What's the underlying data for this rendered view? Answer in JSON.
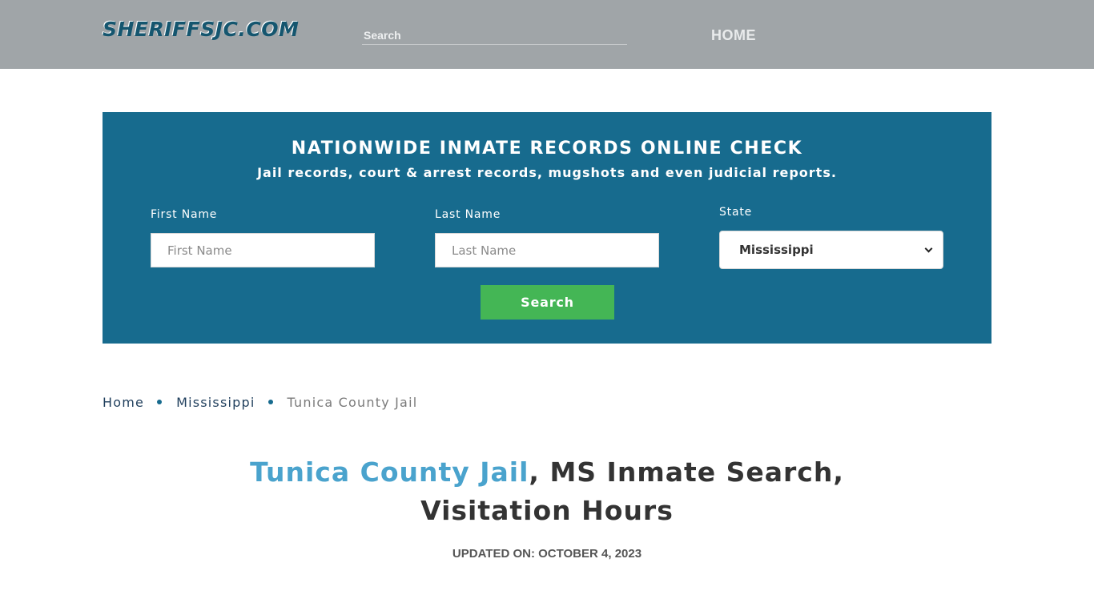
{
  "header": {
    "logo": "SHERIFFSJC.COM",
    "search_placeholder": "Search",
    "nav": {
      "home": "HOME"
    }
  },
  "banner": {
    "title": "NATIONWIDE INMATE RECORDS ONLINE CHECK",
    "subtitle": "Jail records, court & arrest records, mugshots and even judicial reports.",
    "first_name": {
      "label": "First Name",
      "placeholder": "First Name"
    },
    "last_name": {
      "label": "Last Name",
      "placeholder": "Last Name"
    },
    "state": {
      "label": "State",
      "selected": "Mississippi"
    },
    "search_button": "Search"
  },
  "breadcrumb": {
    "items": [
      "Home",
      "Mississippi",
      "Tunica County Jail"
    ]
  },
  "page": {
    "title_accent": "Tunica County Jail",
    "title_rest": ", MS Inmate Search, Visitation Hours",
    "updated": "UPDATED ON: OCTOBER 4, 2023"
  },
  "colors": {
    "header_bg": "#a0a5a8",
    "logo": "#15566f",
    "banner_bg": "#176b8e",
    "search_button": "#44b655",
    "title_accent": "#4aa3cd"
  }
}
